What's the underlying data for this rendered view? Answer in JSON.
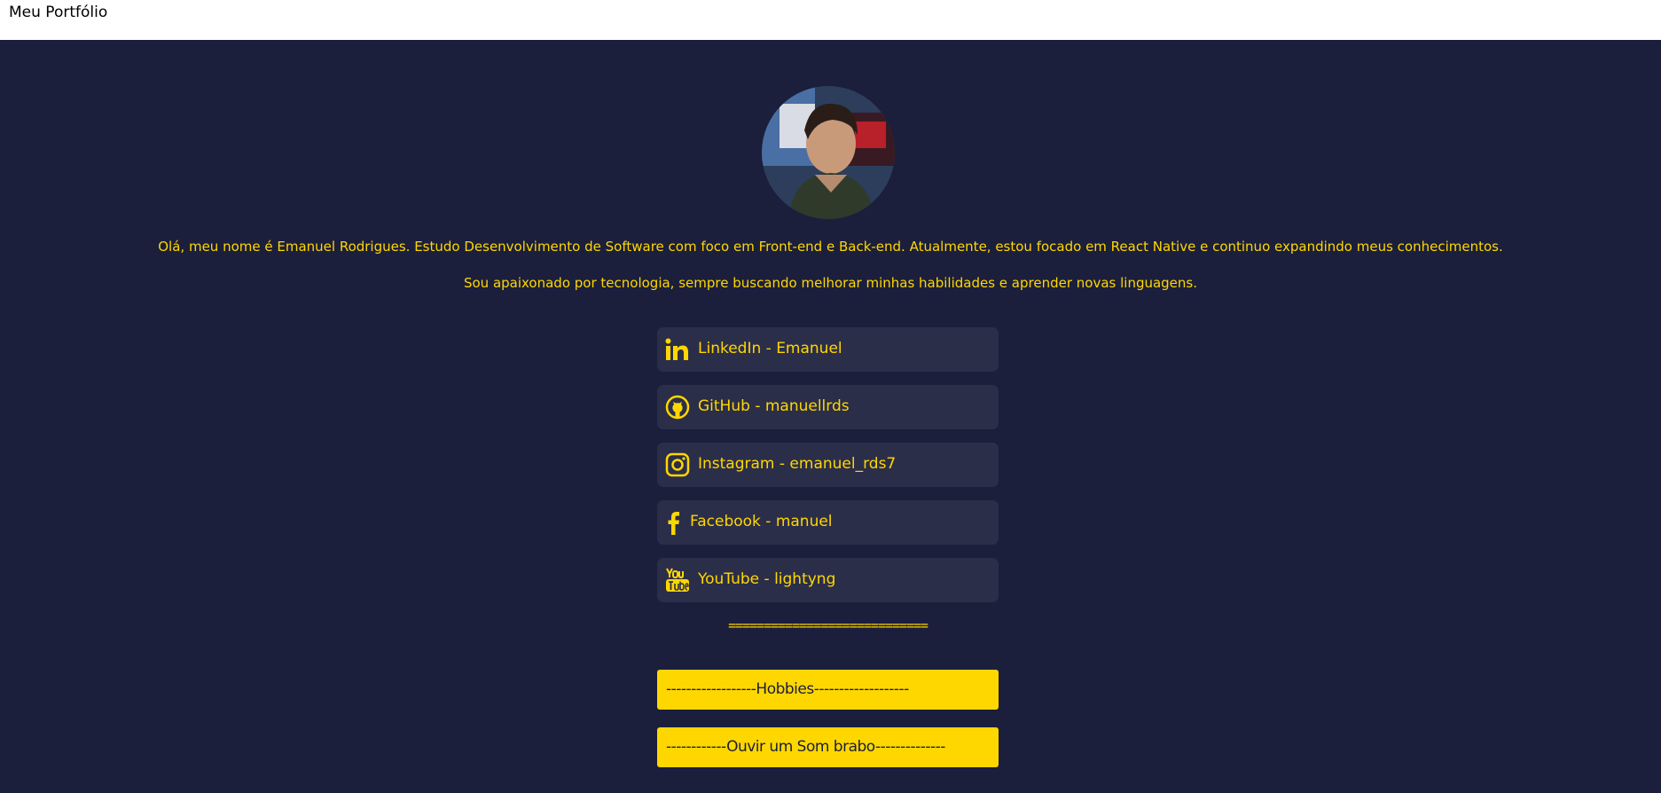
{
  "header": {
    "title": "Meu Portfólio"
  },
  "profile": {
    "avatar_alt": "avatar"
  },
  "intro": {
    "paragraph_1": "Olá, meu nome é Emanuel Rodrigues. Estudo Desenvolvimento de Software com foco em Front-end e Back-end. Atualmente, estou focado em React Native e continuo expandindo meus conhecimentos.",
    "paragraph_2": "Sou apaixonado por tecnologia, sempre buscando melhorar minhas habilidades e aprender novas linguagens."
  },
  "links": [
    {
      "label": "LinkedIn - Emanuel",
      "icon": "linkedin-icon"
    },
    {
      "label": "GitHub - manuellrds",
      "icon": "github-icon"
    },
    {
      "label": "Instagram - emanuel_rds7",
      "icon": "instagram-icon"
    },
    {
      "label": "Facebook - manuel",
      "icon": "facebook-icon"
    },
    {
      "label": "YouTube - lightyng",
      "icon": "youtube-icon"
    }
  ],
  "divider": "============================",
  "buttons": {
    "hobbies": "------------------Hobbies-------------------",
    "music": "------------Ouvir um Som brabo--------------"
  },
  "colors": {
    "background": "#1b1f3b",
    "accent": "#ffd700",
    "card": "#2b2e49",
    "header_bg": "#ffffff"
  }
}
